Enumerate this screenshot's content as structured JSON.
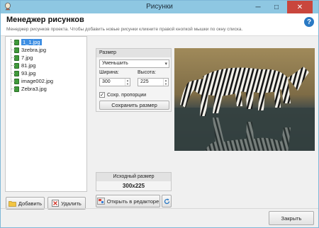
{
  "window": {
    "title": "Рисунки",
    "close_glyph": "✕",
    "minimize_glyph": "─",
    "maximize_glyph": "□"
  },
  "header": {
    "title": "Менеджер рисунков",
    "description": "Менеджер рисунков проекта. Чтобы добавить новые рисунки кликните правой кнопкой мышки по окну списка.",
    "help_glyph": "?"
  },
  "file_list": {
    "items": [
      {
        "name": "1_1.jpg",
        "selected": true
      },
      {
        "name": "3zebra.jpg",
        "selected": false
      },
      {
        "name": "7.jpg",
        "selected": false
      },
      {
        "name": "81.jpg",
        "selected": false
      },
      {
        "name": "93.jpg",
        "selected": false
      },
      {
        "name": "image002.jpg",
        "selected": false
      },
      {
        "name": "Zebra3.jpg",
        "selected": false
      }
    ]
  },
  "buttons": {
    "add": "Добавить",
    "delete": "Удалить",
    "open_in_editor": "Открыть в редакторе",
    "close": "Закрыть",
    "save_size": "Сохранить размер"
  },
  "size_panel": {
    "title": "Размер",
    "mode": "Уменьшить",
    "width_label": "Ширина:",
    "height_label": "Высота:",
    "width_value": "300",
    "height_value": "225",
    "keep_ratio_label": "Сохр. пропорции",
    "keep_ratio_checked": true
  },
  "original_size": {
    "title": "Исходный размер",
    "value": "300x225"
  },
  "colors": {
    "titlebar": "#8ec7e2",
    "selection": "#3d8ee3",
    "close": "#c9463d"
  }
}
